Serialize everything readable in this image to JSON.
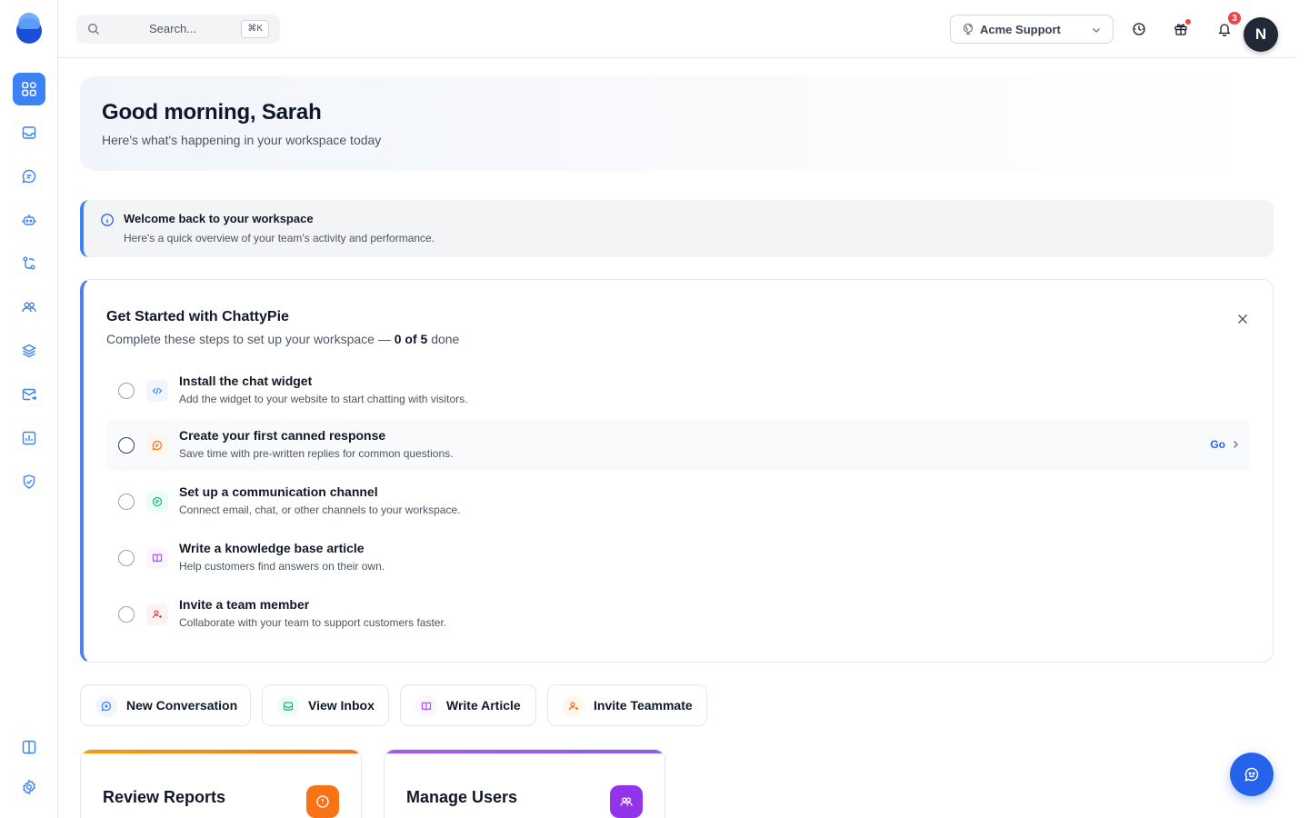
{
  "header": {
    "search_placeholder": "Search...",
    "search_shortcut": "⌘K",
    "workspace": "Acme Support",
    "notification_count": "3",
    "avatar_initial": "N"
  },
  "greeting": {
    "title": "Good morning, Sarah",
    "subtitle": "Here's what's happening in your workspace today"
  },
  "info_banner": {
    "title": "Welcome back to your workspace",
    "text": "Here's a quick overview of your team's activity and performance."
  },
  "getting_started": {
    "title": "Get Started with ChattyPie",
    "subtitle_prefix": "Complete these steps to set up your workspace —",
    "progress": "0 of 5",
    "subtitle_suffix": "done",
    "go_label": "Go",
    "steps": [
      {
        "title": "Install the chat widget",
        "desc": "Add the widget to your website to start chatting with visitors."
      },
      {
        "title": "Create your first canned response",
        "desc": "Save time with pre-written replies for common questions."
      },
      {
        "title": "Set up a communication channel",
        "desc": "Connect email, chat, or other channels to your workspace."
      },
      {
        "title": "Write a knowledge base article",
        "desc": "Help customers find answers on their own."
      },
      {
        "title": "Invite a team member",
        "desc": "Collaborate with your team to support customers faster."
      }
    ]
  },
  "quick_actions": [
    {
      "label": "New Conversation"
    },
    {
      "label": "View Inbox"
    },
    {
      "label": "Write Article"
    },
    {
      "label": "Invite Teammate"
    }
  ],
  "cards": [
    {
      "title": "Review Reports"
    },
    {
      "title": "Manage Users"
    }
  ],
  "colors": {
    "primary": "#3b82f6",
    "badge": "#ef4444",
    "orange": "#f97316",
    "purple": "#a855f7"
  }
}
